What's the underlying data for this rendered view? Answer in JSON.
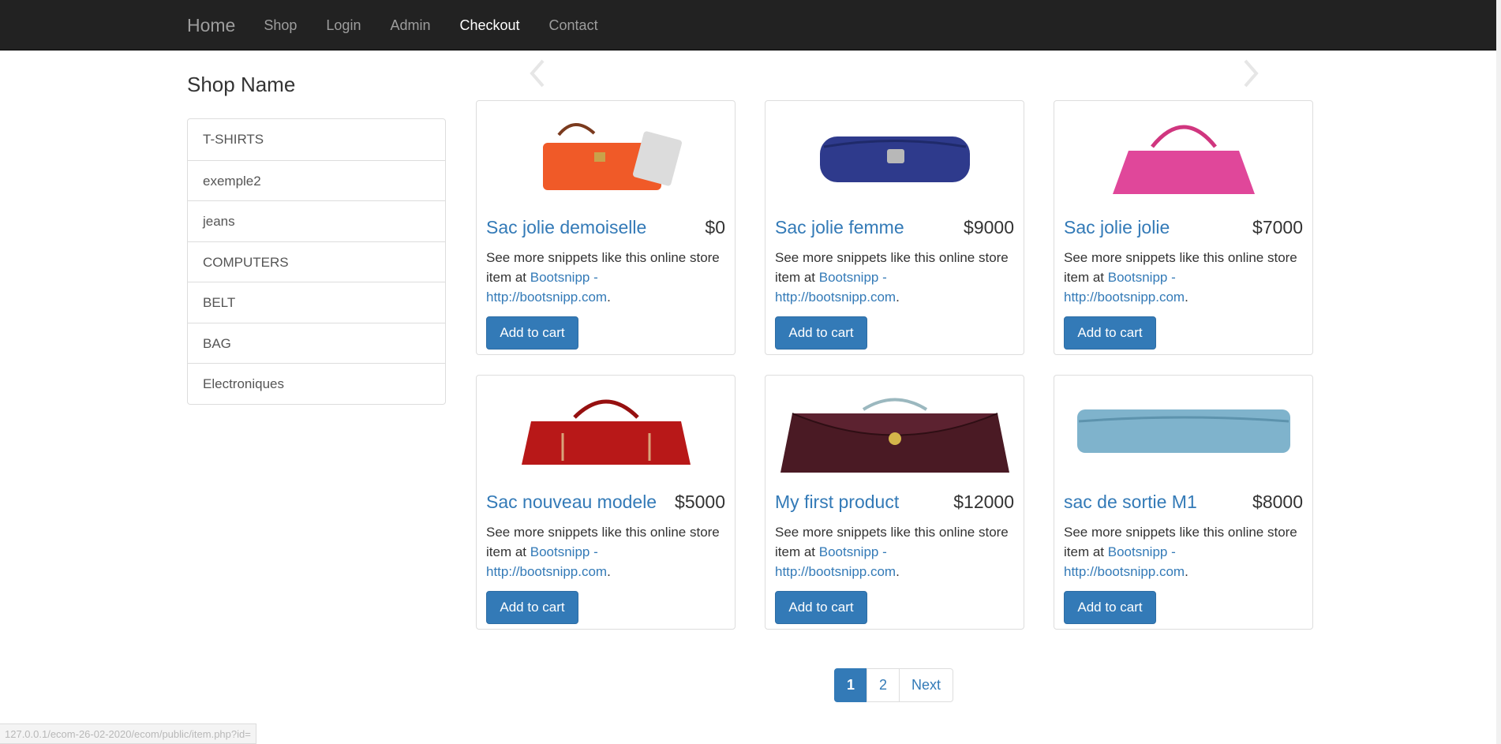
{
  "navbar": {
    "brand": "Home",
    "links": [
      "Shop",
      "Login",
      "Admin",
      "Checkout",
      "Contact"
    ]
  },
  "sidebar": {
    "shop_name": "Shop Name",
    "categories": [
      "T-SHIRTS",
      "exemple2",
      "jeans",
      "COMPUTERS",
      "BELT",
      "BAG",
      "Electroniques"
    ]
  },
  "products": [
    {
      "title": "Sac jolie demoiselle",
      "price": "$0",
      "desc_prefix": "See more snippets like this online store item at ",
      "link": "Bootsnipp - http://bootsnipp.com",
      "desc_suffix": ".",
      "button": "Add to cart",
      "color": "#f05a28"
    },
    {
      "title": "Sac jolie femme",
      "price": "$9000",
      "desc_prefix": "See more snippets like this online store item at ",
      "link": "Bootsnipp - http://bootsnipp.com",
      "desc_suffix": ".",
      "button": "Add to cart",
      "color": "#2e3a8c"
    },
    {
      "title": "Sac jolie jolie",
      "price": "$7000",
      "desc_prefix": "See more snippets like this online store item at ",
      "link": "Bootsnipp - http://bootsnipp.com",
      "desc_suffix": ".",
      "button": "Add to cart",
      "color": "#e0479a"
    },
    {
      "title": "Sac nouveau modele",
      "price": "$5000",
      "desc_prefix": "See more snippets like this online store item at ",
      "link": "Bootsnipp - http://bootsnipp.com",
      "desc_suffix": ".",
      "button": "Add to cart",
      "color": "#b81818"
    },
    {
      "title": "My first product",
      "price": "$12000",
      "desc_prefix": "See more snippets like this online store item at ",
      "link": "Bootsnipp - http://bootsnipp.com",
      "desc_suffix": ".",
      "button": "Add to cart",
      "color": "#4a1a24"
    },
    {
      "title": "sac de sortie M1",
      "price": "$8000",
      "desc_prefix": "See more snippets like this online store item at ",
      "link": "Bootsnipp - http://bootsnipp.com",
      "desc_suffix": ".",
      "button": "Add to cart",
      "color": "#7fb3cc"
    }
  ],
  "pagination": {
    "pages": [
      "1",
      "2"
    ],
    "next": "Next",
    "active": "1"
  },
  "status_bar": {
    "url": "127.0.0.1/ecom-26-02-2020/ecom/public/item.php?id="
  },
  "colors": {
    "navbar_bg": "#222222",
    "link": "#337ab7",
    "button": "#337ab7",
    "active_nav": "#ffffff"
  }
}
